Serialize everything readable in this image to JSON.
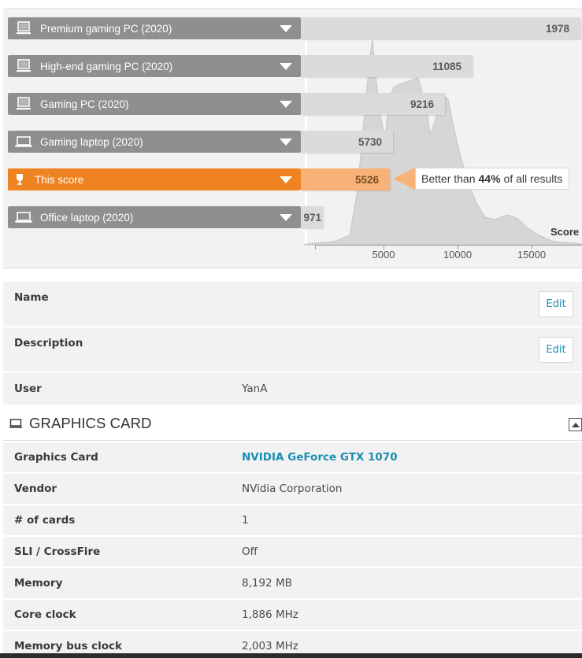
{
  "chart": {
    "rows": [
      {
        "label": "Premium gaming PC (2020)",
        "value": "1978",
        "icon": "desktop-icon"
      },
      {
        "label": "High-end gaming PC (2020)",
        "value": "11085",
        "icon": "desktop-icon"
      },
      {
        "label": "Gaming PC (2020)",
        "value": "9216",
        "icon": "desktop-icon"
      },
      {
        "label": "Gaming laptop (2020)",
        "value": "5730",
        "icon": "laptop-icon"
      },
      {
        "label": "This score",
        "value": "5526",
        "icon": "trophy-icon"
      },
      {
        "label": "Office laptop (2020)",
        "value": "971",
        "icon": "laptop-icon"
      }
    ],
    "callout": {
      "prefix": "Better than",
      "percent": "44%",
      "suffix": "of all results"
    },
    "axis": {
      "title": "Score",
      "ticks": [
        "5000",
        "10000",
        "15000"
      ]
    },
    "colors": {
      "highlight": "#f08321",
      "highlight_bar": "#f8b277",
      "bar": "#dbdbdb",
      "label_bg": "#8f8f8f",
      "distribution": "#d6d6d6"
    }
  },
  "details": {
    "name_label": "Name",
    "description_label": "Description",
    "user_label": "User",
    "user_value": "YanA",
    "edit_label": "Edit"
  },
  "graphics_card": {
    "section_title": "GRAPHICS CARD",
    "rows": [
      {
        "key": "Graphics Card",
        "value": "NVIDIA GeForce GTX 1070"
      },
      {
        "key": "Vendor",
        "value": "NVidia Corporation"
      },
      {
        "key": "# of cards",
        "value": "1"
      },
      {
        "key": "SLI / CrossFire",
        "value": "Off"
      },
      {
        "key": "Memory",
        "value": "8,192 MB"
      },
      {
        "key": "Core clock",
        "value": "1,886 MHz"
      },
      {
        "key": "Memory bus clock",
        "value": "2,003 MHz"
      }
    ]
  }
}
